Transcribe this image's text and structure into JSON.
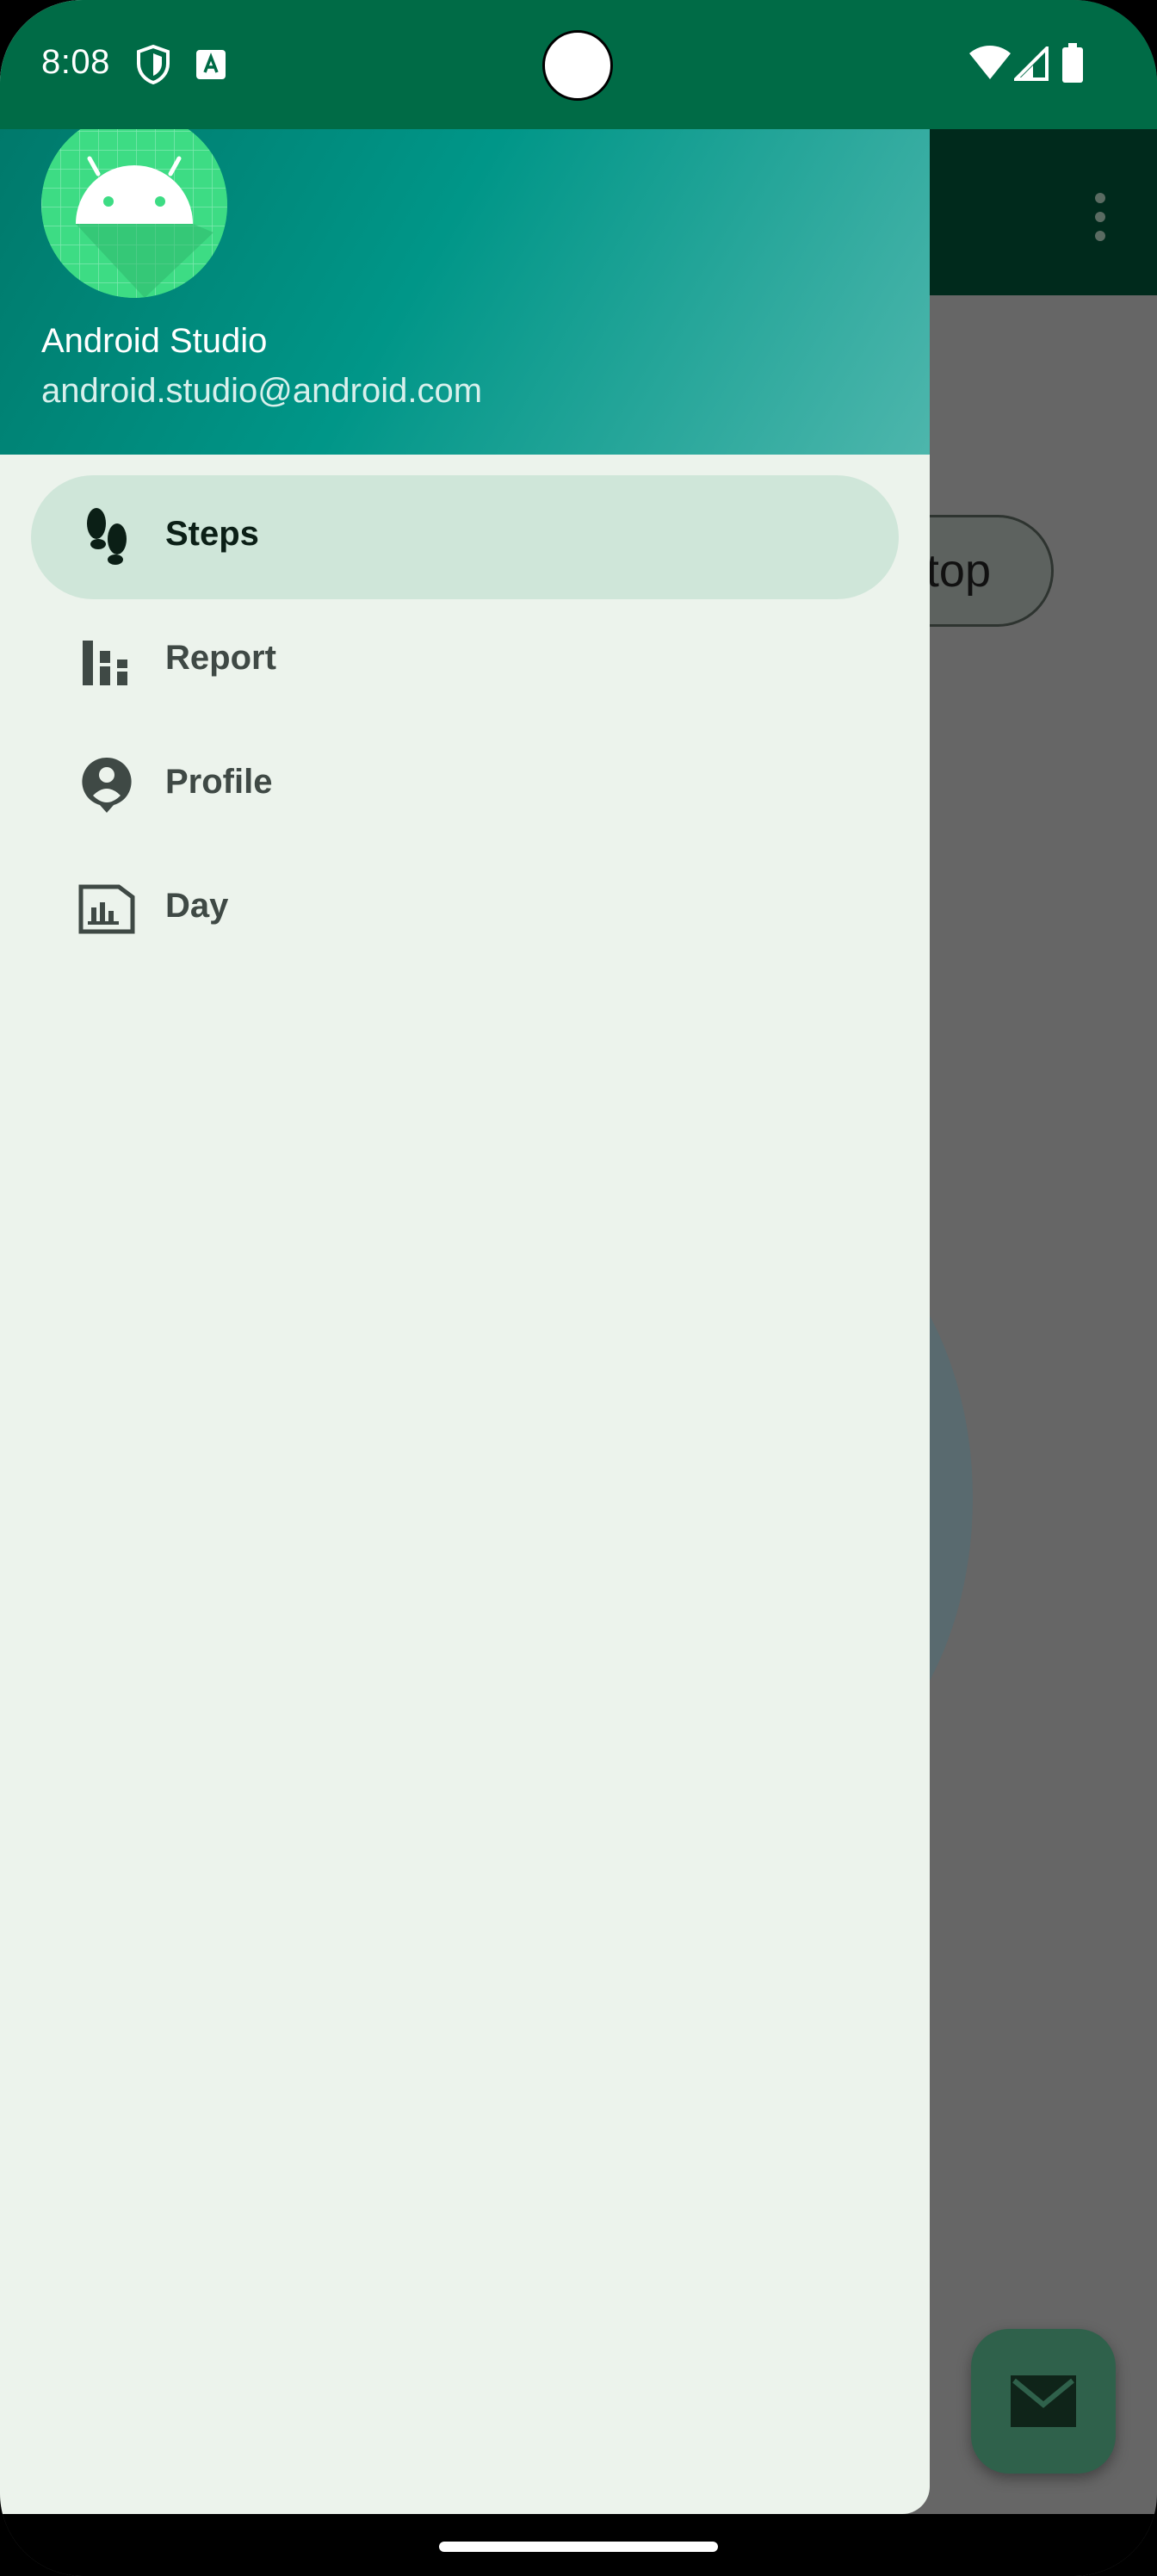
{
  "status_bar": {
    "time": "8:08",
    "left_icons": [
      "shield-icon",
      "a-notification-icon"
    ],
    "right_icons": [
      "wifi-icon",
      "signal-icon",
      "battery-icon"
    ],
    "color": "#006b46"
  },
  "drawer": {
    "header": {
      "name": "Android Studio",
      "email": "android.studio@android.com",
      "avatar_icon": "android-robot-icon"
    },
    "items": [
      {
        "label": "Steps",
        "icon": "footsteps-icon",
        "selected": true
      },
      {
        "label": "Report",
        "icon": "bar-chart-icon",
        "selected": false
      },
      {
        "label": "Profile",
        "icon": "account-pin-icon",
        "selected": false
      },
      {
        "label": "Day",
        "icon": "insert-chart-icon",
        "selected": false
      }
    ]
  },
  "background_app": {
    "button_partial_text": "top",
    "fab_icon": "email-icon",
    "toolbar_menu_icon": "more-vert-icon"
  },
  "colors": {
    "drawer_bg": "#ecf3ec",
    "selected_item_bg": "#cfe6d9",
    "header_gradient_start": "#00796b",
    "header_gradient_end": "#4db6ac",
    "scrim": "#666666"
  }
}
